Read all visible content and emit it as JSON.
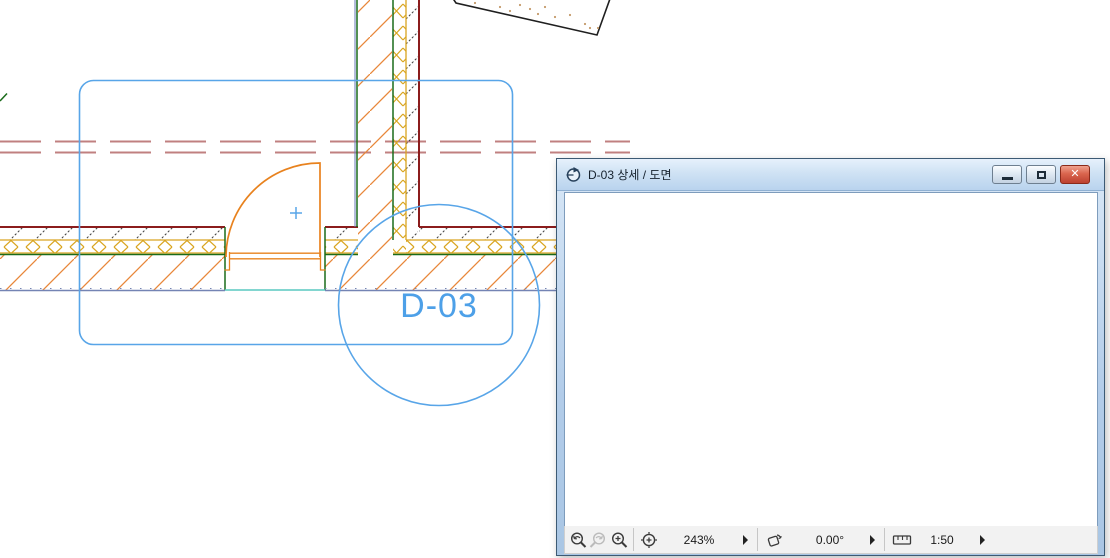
{
  "main_view": {
    "detail_marker_label": "D-03",
    "marker_color": "#58a5e8"
  },
  "popup": {
    "title": "D-03 상세 / 도면",
    "title_icon": "detail-marker-icon",
    "window_buttons": [
      "minimize",
      "restore",
      "close"
    ],
    "toolbar": {
      "zoom_value": "243%",
      "rotation_value": "0.00°",
      "scale_value": "1:50",
      "icons": [
        "zoom-previous",
        "zoom-next",
        "zoom-in",
        "fit-in-window",
        "rotation",
        "scale-ruler"
      ]
    }
  },
  "colors": {
    "marker_blue": "#58a5e8",
    "wall_skin_red": "#8b1c1c",
    "insulation_gold": "#d9a520",
    "finish_green": "#1a6b1a",
    "hatch_orange": "#e8873a",
    "door_orange": "#e8821e",
    "centerline_rose": "#c08080",
    "handle_orange": "#f09040",
    "floor_slate": "#7484b4",
    "threshold_teal": "#58c8c0"
  }
}
